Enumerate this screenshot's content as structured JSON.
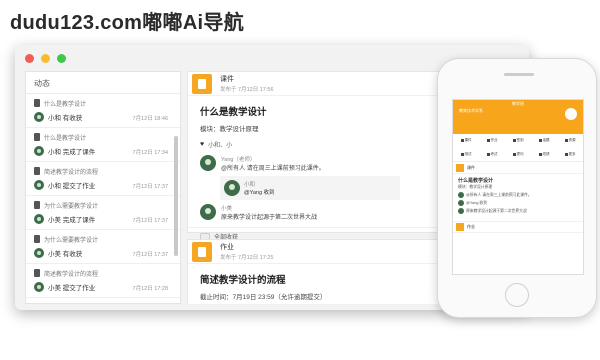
{
  "watermark": "dudu123.com嘟嘟Ai导航",
  "window": {
    "sidebar": {
      "title": "动态",
      "items": [
        {
          "title": "什么是教学设计",
          "user": "小和 有收获",
          "time": "7月12日 18:46"
        },
        {
          "title": "什么是教学设计",
          "user": "小和 完成了课件",
          "time": "7月12日 17:34"
        },
        {
          "title": "简述教学设计的流程",
          "user": "小和 提交了作业",
          "time": "7月12日 17:37"
        },
        {
          "title": "为什么需要教学设计",
          "user": "小美 完成了课件",
          "time": "7月12日 17:37"
        },
        {
          "title": "为什么需要教学设计",
          "user": "小美 有收获",
          "time": "7月12日 17:37"
        },
        {
          "title": "简述教学设计的流程",
          "user": "小美 提交了作业",
          "time": "7月12日 17:28"
        }
      ]
    },
    "card1": {
      "type": "课件",
      "sub": "发布于 7月12日 17:56",
      "title": "什么是教学设计",
      "line": "模块：教学设计原理",
      "likes": "小和、小",
      "comment1_name": "Yang（老师）",
      "comment1_text": "@所有人 请在周三上课前预习此课件。",
      "reply_name": "小和",
      "reply_text": "@Yang 收到",
      "comment2_name": "小美",
      "comment2_text": "原来教学设计起源于第二次世界大战",
      "more": "全部收获"
    },
    "card2": {
      "type": "作业",
      "sub": "发布于 7月12日 17:25",
      "title": "简述教学设计的流程",
      "deadline": "截止时间：7月19日 23:59（允许逾期提交）"
    }
  },
  "phone": {
    "status": "教学班",
    "class_name": "教育技术学系",
    "tools": [
      "课件",
      "作业",
      "签到",
      "话题",
      "资源",
      "测试",
      "考试",
      "提问",
      "成绩",
      "更多"
    ],
    "card_type": "课件",
    "title": "什么是教学设计",
    "line": "模块：教学设计原理",
    "comment1": "@所有人 请在周三上课前预习此课件。",
    "reply": "@Yang 收到",
    "comment2": "原来教学设计起源于第二次世界大战",
    "card2_type": "作业"
  }
}
